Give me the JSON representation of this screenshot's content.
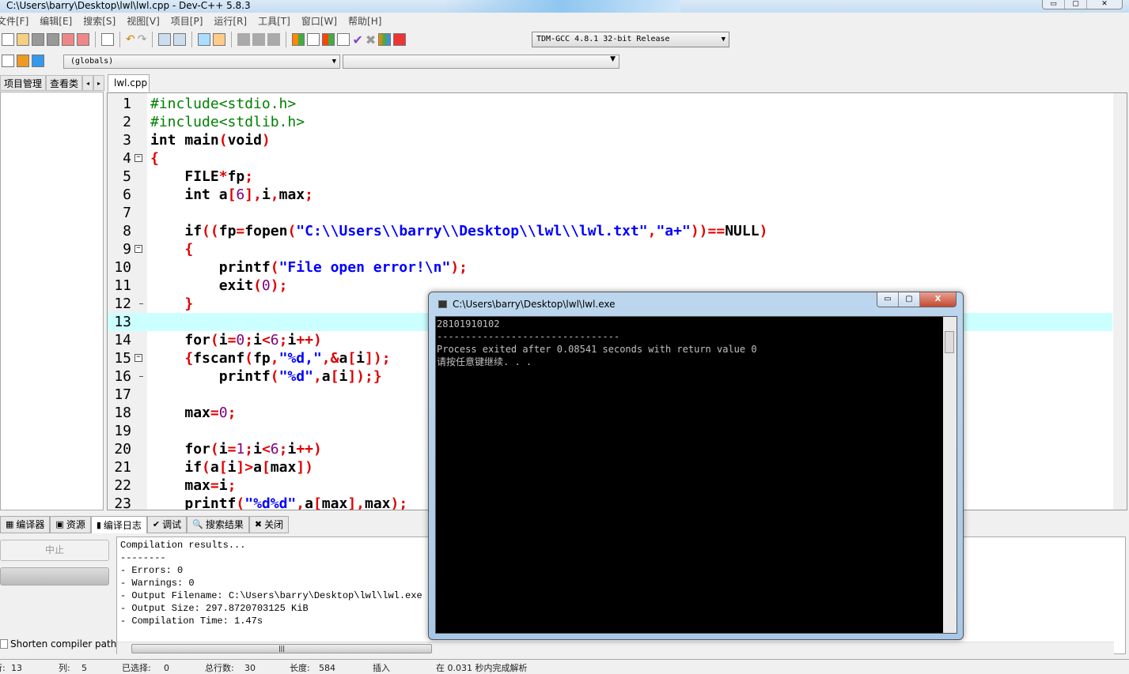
{
  "window": {
    "title": "C:\\Users\\barry\\Desktop\\lwl\\lwl.cpp - Dev-C++ 5.8.3",
    "controls": [
      "▭",
      "▢",
      "✕"
    ]
  },
  "menu": [
    "文件[F]",
    "编辑[E]",
    "搜索[S]",
    "视图[V]",
    "项目[P]",
    "运行[R]",
    "工具[T]",
    "窗口[W]",
    "帮助[H]"
  ],
  "toolbar": {
    "compiler": "TDM-GCC 4.8.1 32-bit Release",
    "scope": "(globals)",
    "function": ""
  },
  "left_tabs": [
    "项目管理",
    "查看类",
    "◂",
    "▸"
  ],
  "editor": {
    "file_tab": "lwl.cpp",
    "current_line": 13,
    "lines": [
      "#include<stdio.h>",
      "#include<stdlib.h>",
      "int main(void)",
      "{",
      "    FILE*fp;",
      "    int a[6],i,max;",
      "",
      "    if((fp=fopen(\"C:\\\\Users\\\\barry\\\\Desktop\\\\lwl\\\\lwl.txt\",\"a+\"))==NULL)",
      "    {",
      "        printf(\"File open error!\\n\");",
      "        exit(0);",
      "    }",
      "",
      "    for(i=0;i<6;i++)",
      "    {fscanf(fp,\"%d,\",&a[i]);",
      "        printf(\"%d\",a[i]);}",
      "",
      "    max=0;",
      "",
      "    for(i=1;i<6;i++)",
      "    if(a[i]>a[max])",
      "    max=i;",
      "    printf(\"%d%d\",a[max],max);"
    ],
    "fold_open": [
      4,
      9,
      15
    ],
    "fold_end": [
      12,
      16
    ]
  },
  "bottom_tabs": [
    {
      "label": "编译器",
      "icon": "compiler-icon"
    },
    {
      "label": "资源",
      "icon": "resources-icon"
    },
    {
      "label": "编译日志",
      "icon": "chart-icon",
      "active": true
    },
    {
      "label": "调试",
      "icon": "check-icon"
    },
    {
      "label": "搜索结果",
      "icon": "search-icon"
    },
    {
      "label": "关闭",
      "icon": "close-icon"
    }
  ],
  "bottom_panel": {
    "stop_button": "中止",
    "shorten_label": "Shorten compiler paths",
    "log": "Compilation results...\n--------\n- Errors: 0\n- Warnings: 0\n- Output Filename: C:\\Users\\barry\\Desktop\\lwl\\lwl.exe\n- Output Size: 297.8720703125 KiB\n- Compilation Time: 1.47s"
  },
  "status": {
    "line_label": "行:",
    "line": "13",
    "col_label": "列:",
    "col": "5",
    "sel_label": "已选择:",
    "sel": "0",
    "total_label": "总行数:",
    "total": "30",
    "len_label": "长度:",
    "len": "584",
    "mode": "插入",
    "parse": "在 0.031 秒内完成解析"
  },
  "console": {
    "title": "C:\\Users\\barry\\Desktop\\lwl\\lwl.exe",
    "controls": [
      "▭",
      "▢",
      "X"
    ],
    "output": "28101910102\n--------------------------------\nProcess exited after 0.08541 seconds with return value 0\n请按任意键继续. . ."
  }
}
